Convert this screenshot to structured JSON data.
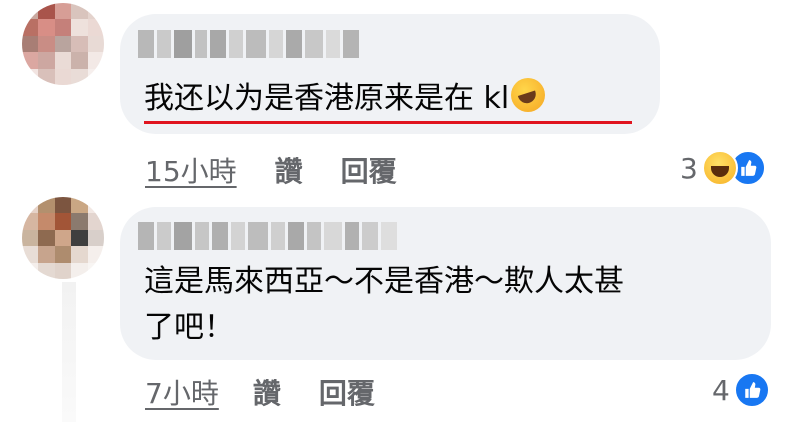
{
  "comments": [
    {
      "text_lines": [
        "我还以为是香港原来是在 kl"
      ],
      "time": "15小時",
      "like_label": "讚",
      "reply_label": "回覆",
      "reaction_count": "3",
      "reaction_icons": [
        "haha-icon",
        "like-icon"
      ],
      "avatar_colors": [
        "#c9a89f",
        "#a9544b",
        "#d79e96",
        "#d9c4bd",
        "#e4d3cd",
        "#b97064",
        "#d88e86",
        "#c5807a",
        "#eee1dc",
        "#ebd9d4",
        "#a87e75",
        "#c98d85",
        "#b9a49e",
        "#d7bdb7",
        "#e8dad5",
        "#dba7a1",
        "#cda7a1",
        "#eadbd6",
        "#cbb2ab",
        "#f3e9e6",
        "#f2e4e1",
        "#d9c0ba",
        "#ead9d4",
        "#e9dcd7",
        "#f6efed"
      ],
      "name_blur_colors": [
        "#b8b8b8",
        "#cacaca",
        "#9f9f9f",
        "#c2c2c2",
        "#a8a8a8",
        "#d0d0d0",
        "#bcbcbc",
        "#d6d6d6",
        "#aaaaaa",
        "#c8c8c8",
        "#dadada",
        "#b4b4b4"
      ]
    },
    {
      "text_lines": [
        "這是馬來西亞～不是香港～欺人太甚",
        "了吧！"
      ],
      "time": "7小時",
      "like_label": "讚",
      "reply_label": "回覆",
      "reaction_count": "4",
      "reaction_icons": [
        "like-icon"
      ],
      "avatar_colors": [
        "#e6d2c8",
        "#b3906e",
        "#7c5540",
        "#caa784",
        "#f2e8e4",
        "#d6b6a1",
        "#c58a6b",
        "#a25537",
        "#8b7a6e",
        "#e3d5cf",
        "#c9b49e",
        "#8e6a50",
        "#cfa68a",
        "#3f3f3f",
        "#d8cfca",
        "#e8ddd6",
        "#c7a48d",
        "#ae8c6e",
        "#e5d8cf",
        "#f5efec",
        "#f4eeeb",
        "#e4d9d2",
        "#e0d3cb",
        "#f4efec",
        "#f8f5f3"
      ],
      "name_blur_colors": [
        "#b5b5b5",
        "#cbcbcb",
        "#a3a3a3",
        "#c6c6c6",
        "#afafaf",
        "#d3d3d3",
        "#bdbdbd",
        "#cfcfcf",
        "#a9a9a9",
        "#c4c4c4",
        "#d8d8d8",
        "#b1b1b1",
        "#cccccc",
        "#dedede"
      ]
    }
  ],
  "colors": {
    "bubble": "#f0f2f5",
    "secondary_text": "#65676b",
    "like_blue": "#1877f2",
    "highlight_underline": "#e0141e"
  }
}
